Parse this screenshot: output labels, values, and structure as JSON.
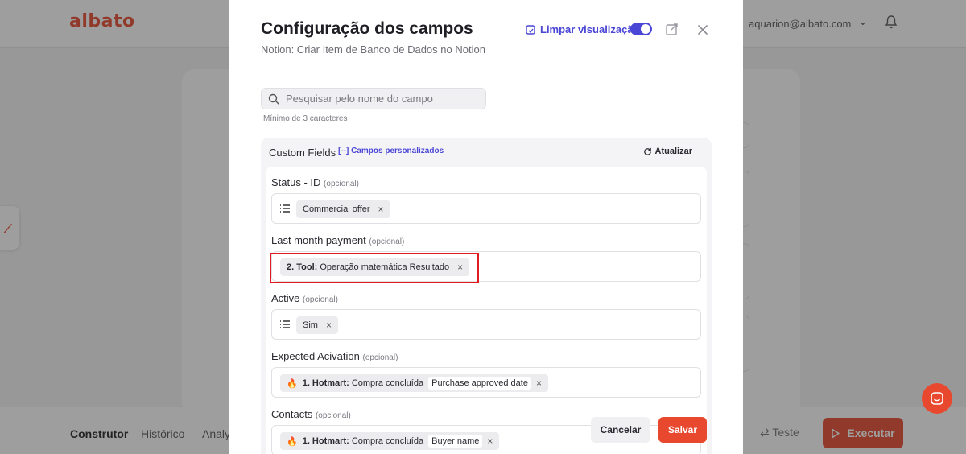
{
  "app": {
    "logo": "albato",
    "user_email": "aquarion@albato.com",
    "bottom_tabs": [
      "Construtor",
      "Histórico",
      "Analyt"
    ],
    "test_label": "Teste",
    "execute_label": "Executar"
  },
  "modal": {
    "title": "Configuração dos campos",
    "subtitle": "Notion: Criar Item de Banco de Dados no Notion",
    "clear_view_label": "Limpar visualização",
    "clear_view_enabled": true,
    "search": {
      "placeholder": "Pesquisar pelo nome do campo",
      "value": ""
    },
    "search_hint": "Mínimo de 3 caracteres",
    "panel": {
      "title": "Custom Fields",
      "tag": "[--] Campos personalizados",
      "refresh_label": "Atualizar"
    },
    "optional_label": "(opcional)",
    "fields": [
      {
        "label": "Status - ID",
        "chip_text": "Commercial offer"
      },
      {
        "label": "Last month payment",
        "chip_bold": "2. Tool:",
        "chip_text": "Operação matemática Resultado"
      },
      {
        "label": "Active",
        "chip_text": "Sim"
      },
      {
        "label": "Expected Acivation",
        "chip_bold": "1. Hotmart:",
        "chip_text": "Compra concluída",
        "chip_inner": "Purchase approved date"
      },
      {
        "label": "Contacts",
        "chip_bold": "1. Hotmart:",
        "chip_text": "Compra concluída",
        "chip_inner": "Buyer name"
      }
    ],
    "cancel_label": "Cancelar",
    "save_label": "Salvar"
  },
  "colors": {
    "brand": "#e8492e",
    "accent": "#4a46d6",
    "highlight": "#e01b22"
  }
}
